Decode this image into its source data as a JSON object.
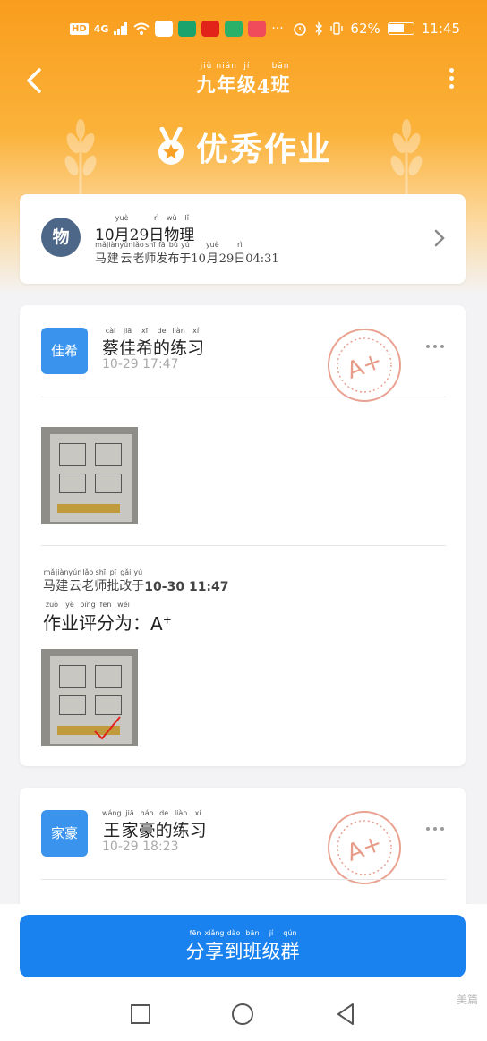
{
  "status_bar": {
    "hd": "HD",
    "network": "4G",
    "dots": "···",
    "battery_percent": "62%",
    "battery_level": 0.62,
    "time": "11:45"
  },
  "nav": {
    "title_chars": [
      {
        "ch": "九",
        "py": "jiǔ"
      },
      {
        "ch": "年",
        "py": "nián"
      },
      {
        "ch": "级",
        "py": "jí"
      },
      {
        "ch": "4",
        "py": ""
      },
      {
        "ch": "班",
        "py": "bān"
      }
    ]
  },
  "hero": {
    "title": "优秀作业"
  },
  "homework": {
    "subject_badge": "物",
    "title_prefix": "10",
    "title_chars": [
      {
        "ch": "月",
        "py": "yuè"
      },
      {
        "ch": "29",
        "py": ""
      },
      {
        "ch": "日",
        "py": "rì"
      },
      {
        "ch": "物",
        "py": "wù"
      },
      {
        "ch": "理",
        "py": "lǐ"
      }
    ],
    "subtitle_chars": [
      {
        "ch": "马",
        "py": "mǎ"
      },
      {
        "ch": "建",
        "py": "jiàn"
      },
      {
        "ch": "云",
        "py": "yún"
      },
      {
        "ch": "老",
        "py": "lǎo"
      },
      {
        "ch": "师",
        "py": "shī"
      },
      {
        "ch": "发",
        "py": "fā"
      },
      {
        "ch": "布",
        "py": "bù"
      },
      {
        "ch": "于",
        "py": "yú"
      },
      {
        "ch": "10",
        "py": ""
      },
      {
        "ch": "月",
        "py": "yuè"
      },
      {
        "ch": "29",
        "py": ""
      },
      {
        "ch": "日",
        "py": "rì"
      },
      {
        "ch": "04:31",
        "py": ""
      }
    ]
  },
  "submissions": [
    {
      "avatar": "佳希",
      "name_chars": [
        {
          "ch": "蔡",
          "py": "cài"
        },
        {
          "ch": "佳",
          "py": "jiā"
        },
        {
          "ch": "希",
          "py": "xī"
        },
        {
          "ch": "的",
          "py": "de"
        },
        {
          "ch": "练",
          "py": "liàn"
        },
        {
          "ch": "习",
          "py": "xí"
        }
      ],
      "time": "10-29 17:47",
      "stamp_grade": "A+",
      "review": {
        "teacher_chars": [
          {
            "ch": "马",
            "py": "mǎ"
          },
          {
            "ch": "建",
            "py": "jiàn"
          },
          {
            "ch": "云",
            "py": "yún"
          },
          {
            "ch": "老",
            "py": "lǎo"
          },
          {
            "ch": "师",
            "py": "shī"
          },
          {
            "ch": "批",
            "py": "pī"
          },
          {
            "ch": "改",
            "py": "gǎi"
          },
          {
            "ch": "于",
            "py": "yú"
          }
        ],
        "review_time": "10-30 11:47",
        "grade_chars": [
          {
            "ch": "作",
            "py": "zuò"
          },
          {
            "ch": "业",
            "py": "yè"
          },
          {
            "ch": "评",
            "py": "píng"
          },
          {
            "ch": "分",
            "py": "fēn"
          },
          {
            "ch": "为",
            "py": "wéi"
          },
          {
            "ch": "：",
            "py": ""
          }
        ],
        "grade": "A",
        "grade_sup": "+"
      }
    },
    {
      "avatar": "家豪",
      "name_chars": [
        {
          "ch": "王",
          "py": "wáng"
        },
        {
          "ch": "家",
          "py": "jiā"
        },
        {
          "ch": "豪",
          "py": "háo"
        },
        {
          "ch": "的",
          "py": "de"
        },
        {
          "ch": "练",
          "py": "liàn"
        },
        {
          "ch": "习",
          "py": "xí"
        }
      ],
      "time": "10-29 18:23",
      "stamp_grade": "A+"
    }
  ],
  "share_button": {
    "chars": [
      {
        "ch": "分",
        "py": "fēn"
      },
      {
        "ch": "享",
        "py": "xiǎng"
      },
      {
        "ch": "到",
        "py": "dào"
      },
      {
        "ch": "班",
        "py": "bān"
      },
      {
        "ch": "级",
        "py": "jí"
      },
      {
        "ch": "群",
        "py": "qún"
      }
    ]
  },
  "watermark": "美篇",
  "colors": {
    "brand_orange": "#f99d1d",
    "button_blue": "#1a82ef",
    "avatar_blue": "#3a94ee",
    "subject_badge": "#4d6788",
    "stamp_red": "#e07b62"
  }
}
